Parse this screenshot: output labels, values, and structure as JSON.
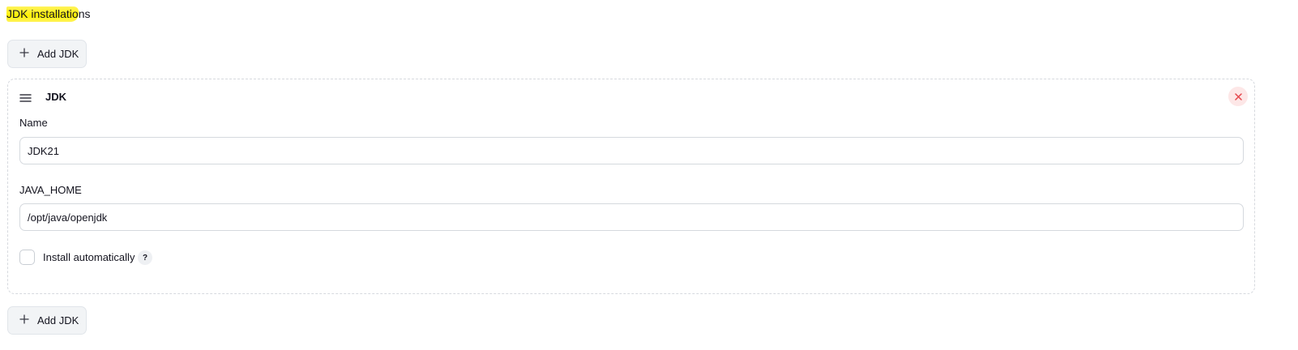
{
  "section": {
    "title_highlighted": "JDK installatio",
    "title_rest": "ns"
  },
  "add_button_top": {
    "label": "Add JDK",
    "icon": "plus-icon"
  },
  "add_button_bottom": {
    "label": "Add JDK",
    "icon": "plus-icon"
  },
  "jdk_card": {
    "title": "JDK",
    "drag_icon": "hamburger-icon",
    "close_icon": "close-icon",
    "name_label": "Name",
    "name_value": "JDK21",
    "java_home_label": "JAVA_HOME",
    "java_home_value": "/opt/java/openjdk",
    "install_automatically_label": "Install automatically",
    "install_automatically_checked": false,
    "help_text": "?"
  },
  "colors": {
    "highlight": "#fff100",
    "close_bg": "#fde7e7",
    "close_x": "#e5484d",
    "button_bg": "#f2f4f6"
  }
}
